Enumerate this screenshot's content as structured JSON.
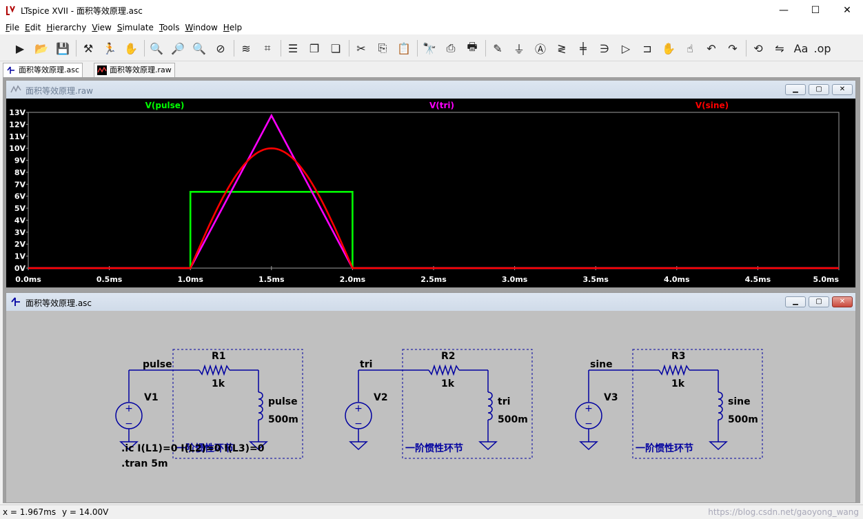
{
  "window": {
    "title": "LTspice XVII - 面积等效原理.asc",
    "controls": {
      "minimize": "—",
      "maximize": "☐",
      "close": "✕"
    }
  },
  "menu": [
    {
      "ul": "F",
      "rest": "ile"
    },
    {
      "ul": "E",
      "rest": "dit"
    },
    {
      "ul": "H",
      "rest": "ierarchy"
    },
    {
      "ul": "V",
      "rest": "iew"
    },
    {
      "ul": "S",
      "rest": "imulate"
    },
    {
      "ul": "T",
      "rest": "ools"
    },
    {
      "ul": "W",
      "rest": "indow"
    },
    {
      "ul": "H",
      "rest": "elp"
    }
  ],
  "toolbar_icons": [
    "run-icon",
    "open-icon",
    "save-icon",
    "control-panel-icon",
    "halt-icon",
    "pan-hand-icon",
    "zoom-in-icon",
    "zoom-area-icon",
    "zoom-out-icon",
    "zoom-full-icon",
    "autorange-icon",
    "fft-icon",
    "tile-horizontal-icon",
    "cascade-icon",
    "tile-vertical-icon",
    "cut-icon",
    "copy-icon",
    "paste-icon",
    "find-icon",
    "print-icon",
    "print-setup-icon",
    "draw-wire-icon",
    "ground-icon",
    "label-net-icon",
    "resistor-icon",
    "capacitor-icon",
    "inductor-icon",
    "diode-icon",
    "component-icon",
    "move-icon",
    "drag-icon",
    "undo-icon",
    "redo-icon",
    "rotate-icon",
    "mirror-icon",
    "text-icon",
    "spice-directive-icon"
  ],
  "tabs": [
    {
      "label": "面积等效原理.asc",
      "active": true
    },
    {
      "label": "面积等效原理.raw",
      "active": false
    }
  ],
  "waveform_window": {
    "title": "面积等效原理.raw",
    "chart_data": {
      "type": "line",
      "xlabel": "",
      "ylabel": "",
      "xlim": [
        0,
        5
      ],
      "ylim": [
        0,
        13
      ],
      "x_ticks": [
        "0.0ms",
        "0.5ms",
        "1.0ms",
        "1.5ms",
        "2.0ms",
        "2.5ms",
        "3.0ms",
        "3.5ms",
        "4.0ms",
        "4.5ms",
        "5.0ms"
      ],
      "y_ticks": [
        "0V",
        "1V",
        "2V",
        "3V",
        "4V",
        "5V",
        "6V",
        "7V",
        "8V",
        "9V",
        "10V",
        "11V",
        "12V",
        "13V"
      ],
      "series": [
        {
          "name": "V(pulse)",
          "color": "#00ff00",
          "x": [
            0,
            1,
            1,
            2,
            2,
            5
          ],
          "y": [
            0,
            0,
            6.37,
            6.37,
            0,
            0
          ]
        },
        {
          "name": "V(tri)",
          "color": "#ff00ff",
          "x": [
            0,
            1,
            1.5,
            2,
            5
          ],
          "y": [
            0,
            0,
            12.73,
            0,
            0
          ]
        },
        {
          "name": "V(sine)",
          "color": "#ff0000",
          "x": [
            0,
            1,
            1.1,
            1.2,
            1.3,
            1.4,
            1.5,
            1.6,
            1.7,
            1.8,
            1.9,
            2,
            5
          ],
          "y": [
            0,
            0,
            3.09,
            5.88,
            8.09,
            9.51,
            10,
            9.51,
            8.09,
            5.88,
            3.09,
            0,
            0
          ]
        }
      ]
    }
  },
  "schematic_window": {
    "title": "面积等效原理.asc",
    "circuits": [
      {
        "net": "pulse",
        "source": "V1",
        "resistor": "R1",
        "r_value": "1k",
        "l_net": "pulse",
        "l_value": "500m",
        "block_label": "一阶惯性环节"
      },
      {
        "net": "tri",
        "source": "V2",
        "resistor": "R2",
        "r_value": "1k",
        "l_net": "tri",
        "l_value": "500m",
        "block_label": "一阶惯性环节"
      },
      {
        "net": "sine",
        "source": "V3",
        "resistor": "R3",
        "r_value": "1k",
        "l_net": "sine",
        "l_value": "500m",
        "block_label": "一阶惯性环节"
      }
    ],
    "directives": [
      ".ic I(L1)=0 I(L2)=0 I(L3)=0",
      ".tran 5m"
    ]
  },
  "status": {
    "x_readout": "x = 1.967ms",
    "y_readout": "y = 14.00V",
    "watermark": "https://blog.csdn.net/gaoyong_wang"
  }
}
